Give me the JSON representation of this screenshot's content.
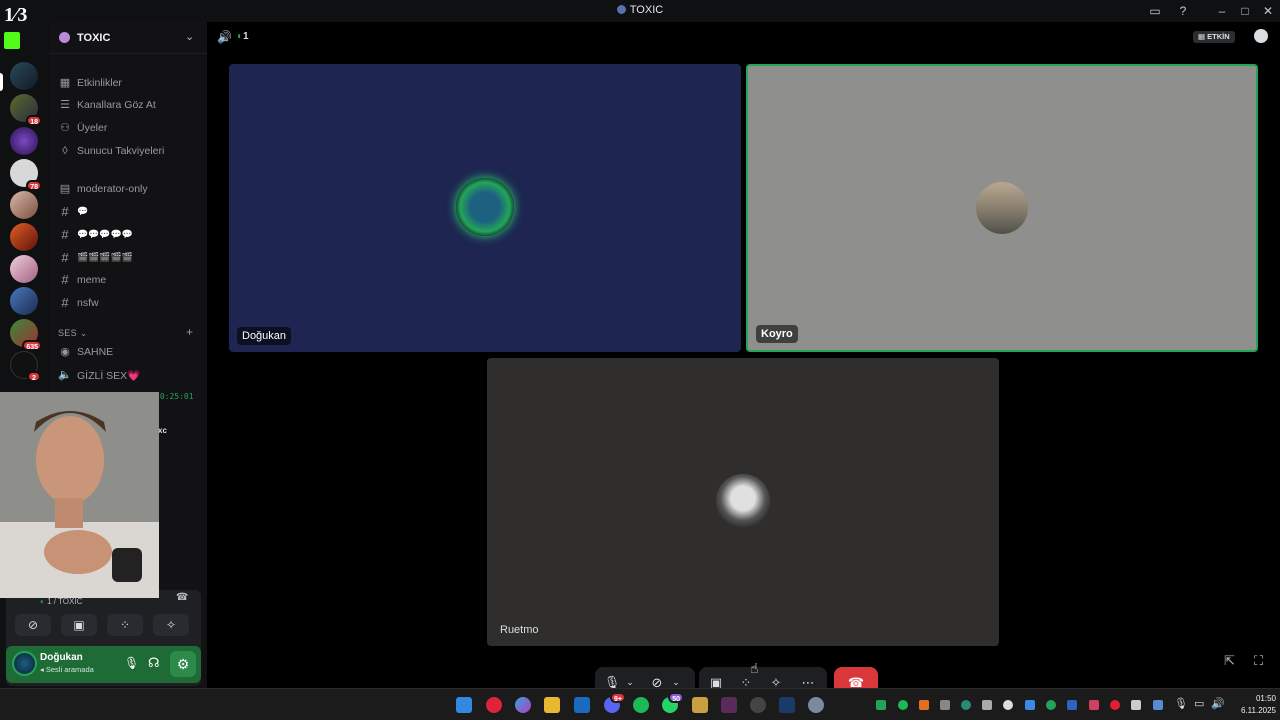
{
  "window": {
    "title": "TOXIC"
  },
  "overlay_counter": "1⁄3",
  "rail": {
    "badges": [
      "18",
      "78",
      "635",
      "2"
    ]
  },
  "sidebar": {
    "server_name": "TOXIC",
    "nav": [
      {
        "label": "Etkinlikler",
        "icon": "calendar-icon"
      },
      {
        "label": "Kanallara Göz At",
        "icon": "browse-channels-icon"
      },
      {
        "label": "Üyeler",
        "icon": "members-icon"
      },
      {
        "label": "Sunucu Takviyeleri",
        "icon": "boost-icon"
      }
    ],
    "channels": [
      {
        "label": "moderator-only",
        "icon": "rules-icon"
      },
      {
        "label": "💬",
        "icon": "hash-icon"
      },
      {
        "label": "💬💬💬💬💬",
        "icon": "hash-icon"
      },
      {
        "label": "🎬🎬🎬🎬🎬",
        "icon": "hash-icon"
      },
      {
        "label": "meme",
        "icon": "hash-icon"
      },
      {
        "label": "nsfw",
        "icon": "hash-icon"
      }
    ],
    "voice_section": "SES",
    "voice_channels": [
      {
        "label": "SAHNE",
        "icon": "stage-icon"
      },
      {
        "label": "GİZLİ SEX💗",
        "icon": "speaker-icon"
      }
    ],
    "call_timer": "10:25:01",
    "partial_text": "xc",
    "voice_status": "1 / TOXIC",
    "user": {
      "name": "Doğukan",
      "status": "Sesli aramada"
    }
  },
  "topbar": {
    "participants": "1",
    "activity_label": "ETKİN"
  },
  "tiles": [
    {
      "name": "Doğukan",
      "bg": "#1d2550"
    },
    {
      "name": "Koyro",
      "bg": "#8f908d",
      "speaking": true
    },
    {
      "name": "Ruetmo",
      "bg": "#2f2e2d"
    }
  ],
  "taskbar": {
    "time": "01:50",
    "date": "6.11.2025",
    "badges": {
      "discord": "9+",
      "whatsapp": "50"
    }
  },
  "colors": {
    "accent_green": "#23a559",
    "hangup": "#da373c",
    "speaking_border": "#23a559"
  }
}
